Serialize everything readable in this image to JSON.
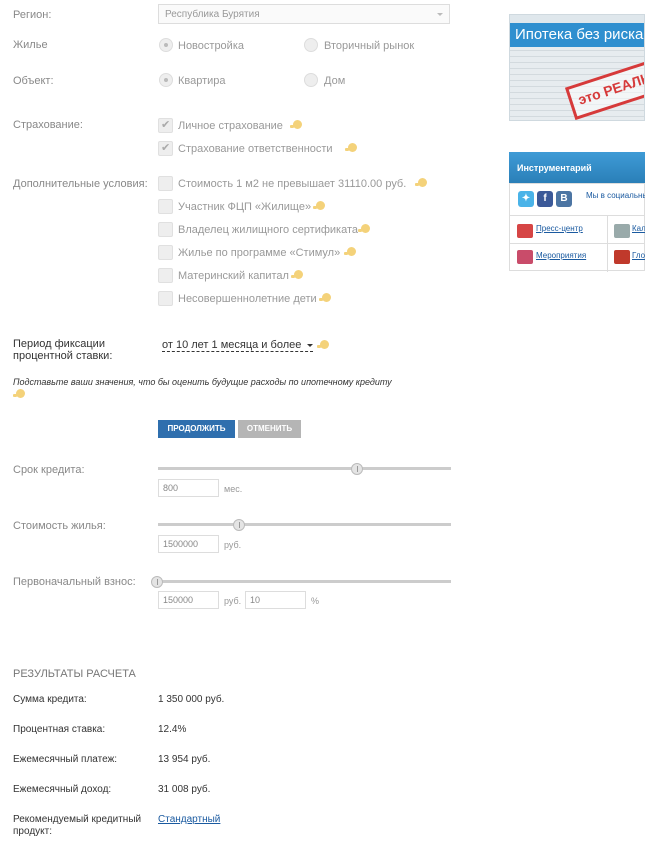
{
  "form": {
    "region_label": "Регион:",
    "region_value": "Республика Бурятия",
    "housing_label": "Жилье",
    "housing_options": [
      "Новостройка",
      "Вторичный рынок"
    ],
    "object_label": "Объект:",
    "object_options": [
      "Квартира",
      "Дом"
    ],
    "insurance_label": "Страхование:",
    "insurance_options": [
      "Личное страхование",
      "Страхование ответственности"
    ],
    "extra_label": "Дополнительные условия:",
    "extra_options": [
      "Стоимость 1 м2 не превышает 31110.00 руб.",
      "Участник ФЦП «Жилище»",
      "Владелец жилищного сертификата",
      "Жилье по программе «Стимул»",
      "Материнский капитал",
      "Несовершеннолетние дети"
    ],
    "period_label_line1": "Период фиксации",
    "period_label_line2": "процентной ставки:",
    "period_value": "от 10 лет 1 месяца и более",
    "note": "Подставьте ваши значения, что бы оценить будущие расходы по ипотечному кредиту",
    "continue_label": "ПРОДОЛЖИТЬ",
    "cancel_label": "ОТМЕНИТЬ"
  },
  "sliders": {
    "term_label": "Срок кредита:",
    "term_value": "800",
    "term_unit": "мес.",
    "term_level": 0.68,
    "price_label": "Стоимость жилья:",
    "price_value": "1500000",
    "price_unit": "руб.",
    "price_level": 0.28,
    "down_label": "Первоначальный взнос:",
    "down_value": "150000",
    "down_unit": "руб.",
    "down_percent": "10",
    "down_percent_unit": "%",
    "down_level": 0.0
  },
  "results": {
    "heading": "РЕЗУЛЬТАТЫ РАСЧЕТА",
    "loan_label": "Сумма кредита:",
    "loan_value": "1 350 000 руб.",
    "rate_label": "Процентная ставка:",
    "rate_value": "12.4%",
    "payment_label": "Ежемесячный платеж:",
    "payment_value": "13 954 руб.",
    "income_label": "Ежемесячный доход:",
    "income_value": "31 008 руб.",
    "product_label_line1": "Рекомендуемый кредитный",
    "product_label_line2": "продукт:",
    "product_value": "Стандартный"
  },
  "sidebar": {
    "banner_title": "Ипотека без риска",
    "banner_stamp": "это РЕАЛЬНО",
    "tools_title": "Инструментарий",
    "social_text": "Мы в социальны",
    "social_vk": "В",
    "social_fb": "f",
    "links": [
      "Пресс-центр",
      "Кал",
      "Мероприятия",
      "Гло"
    ]
  },
  "colors": {
    "primary_button": "#2f6fae",
    "secondary_button": "#b5b5b5",
    "link": "#1a5aa0",
    "accent_blue": "#2f8fcf"
  }
}
